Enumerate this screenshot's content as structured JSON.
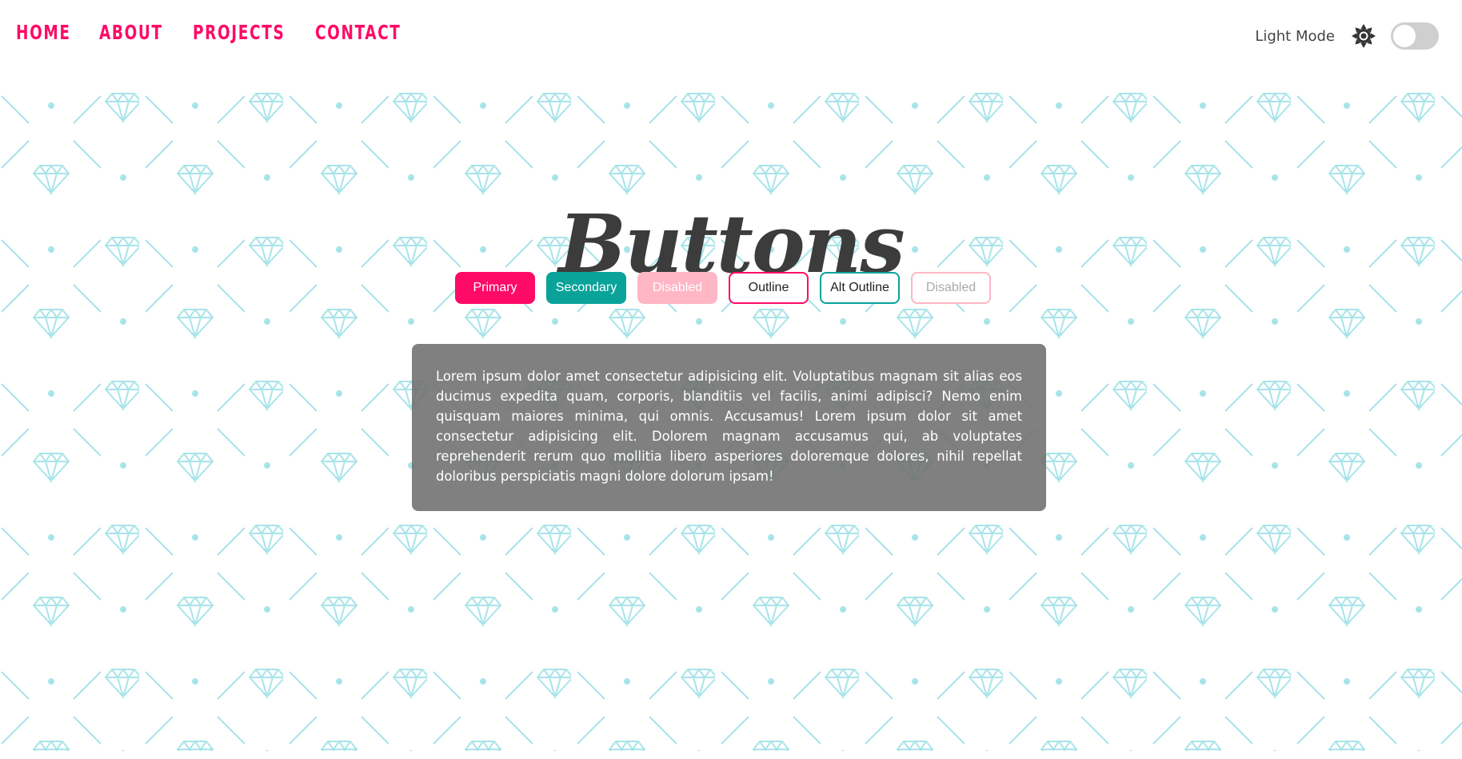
{
  "nav": {
    "items": [
      {
        "label": "HOME"
      },
      {
        "label": "ABOUT"
      },
      {
        "label": "PROJECTS"
      },
      {
        "label": "CONTACT"
      }
    ]
  },
  "theme": {
    "label": "Light Mode",
    "icon": "sun-icon",
    "dark_mode_enabled": false
  },
  "page": {
    "title": "Buttons"
  },
  "buttons": [
    {
      "label": "Primary",
      "variant": "primary"
    },
    {
      "label": "Secondary",
      "variant": "secondary"
    },
    {
      "label": "Disabled",
      "variant": "disabled"
    },
    {
      "label": "Outline",
      "variant": "outline"
    },
    {
      "label": "Alt Outline",
      "variant": "alt-outline"
    },
    {
      "label": "Disabled",
      "variant": "outline-disabled"
    }
  ],
  "card": {
    "text": "Lorem ipsum dolor amet consectetur adipisicing elit. Voluptatibus magnam sit alias eos ducimus expedita quam, corporis, blanditiis vel facilis, animi adipisci? Nemo enim quisquam maiores minima, qui omnis. Accusamus! Lorem ipsum dolor sit amet consectetur adipisicing elit. Dolorem magnam accusamus qui, ab voluptates reprehenderit rerum quo mollitia libero asperiores doloremque dolores, nihil repellat doloribus perspiciatis magni dolore dolorum ipsam!"
  },
  "colors": {
    "accent": "#ff0a67",
    "secondary": "#0aa39a",
    "disabled": "#ffb6c5",
    "pattern": "#a8e4ea",
    "title": "#3c3c3c"
  }
}
